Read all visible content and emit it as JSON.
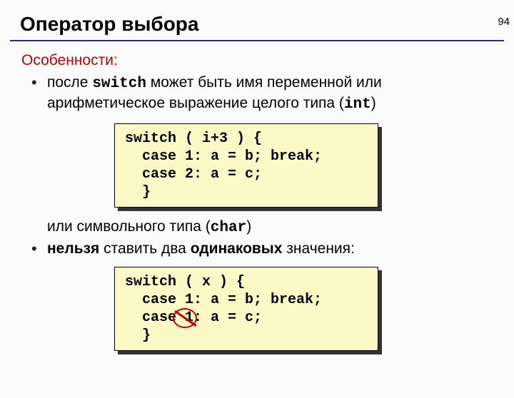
{
  "page_number": "94",
  "title": "Оператор выбора",
  "subhead": "Особенности:",
  "bullet1": {
    "pre": "после ",
    "kw1": "switch",
    "mid": " может быть имя переменной или арифметическое выражение целого типа (",
    "kw2": "int",
    "post": ")"
  },
  "code1": "switch ( i+3 ) {\n  case 1: a = b; break;\n  case 2: a = c;\n  }",
  "continuation": {
    "pre": "или символьного типа (",
    "kw": "char",
    "post": ")"
  },
  "bullet2": {
    "strong1": "нельзя",
    "mid": " ставить два ",
    "strong2": "одинаковых",
    "post": " значения:"
  },
  "code2": "switch ( x ) {\n  case 1: a = b; break;\n  case 1: a = c;\n  }"
}
